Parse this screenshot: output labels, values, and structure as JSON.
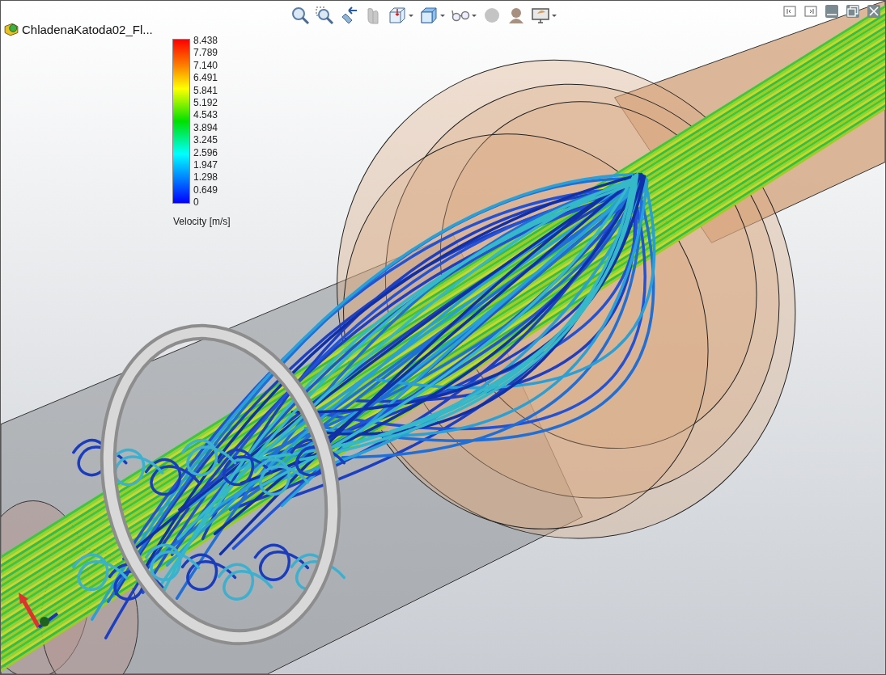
{
  "document": {
    "title": "ChladenaKatoda02_Fl..."
  },
  "legend": {
    "title": "Velocity [m/s]",
    "ticks": [
      "8.438",
      "7.789",
      "7.140",
      "6.491",
      "5.841",
      "5.192",
      "4.543",
      "3.894",
      "3.245",
      "2.596",
      "1.947",
      "1.298",
      "0.649",
      "0"
    ]
  }
}
